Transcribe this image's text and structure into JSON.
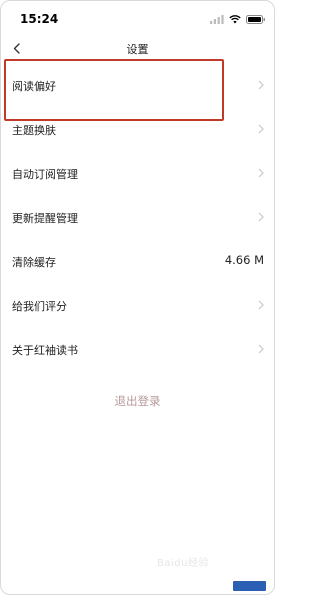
{
  "status_bar": {
    "time": "15:24"
  },
  "nav": {
    "title": "设置"
  },
  "settings": {
    "items": [
      {
        "label": "阅读偏好",
        "value": ""
      },
      {
        "label": "主题换肤",
        "value": ""
      },
      {
        "label": "自动订阅管理",
        "value": ""
      },
      {
        "label": "更新提醒管理",
        "value": ""
      },
      {
        "label": "清除缓存",
        "value": "4.66 M"
      },
      {
        "label": "给我们评分",
        "value": ""
      },
      {
        "label": "关于红袖读书",
        "value": ""
      }
    ],
    "logout_label": "退出登录"
  },
  "watermark": {
    "text": "Baidu经验"
  },
  "colors": {
    "highlight_border": "#c0392b",
    "logout_text": "#b89a9a",
    "chevron": "#c8c8c8"
  },
  "icons": [
    "signal-icon",
    "wifi-icon",
    "battery-icon",
    "back-chevron-icon",
    "chevron-right-icon"
  ]
}
